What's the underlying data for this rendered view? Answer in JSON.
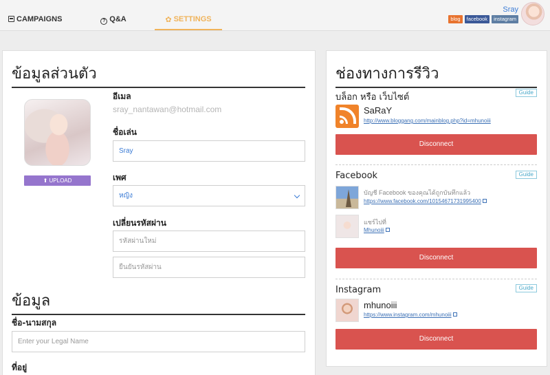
{
  "nav": {
    "tabs": [
      {
        "label": "CAMPAIGNS",
        "icon": "campaigns-icon"
      },
      {
        "label": "Q&A",
        "icon": "question-icon"
      },
      {
        "label": "SETTINGS",
        "icon": "gear-icon",
        "active": true
      }
    ],
    "user": {
      "name": "Sray",
      "badges": [
        "blog",
        "facebook",
        "instagram"
      ]
    }
  },
  "personal": {
    "title": "ข้อมูลส่วนตัว",
    "upload_label": "UPLOAD",
    "email_label": "อีเมล",
    "email_value": "sray_nantawan@hotmail.com",
    "nickname_label": "ชื่อเล่น",
    "nickname_value": "Sray",
    "gender_label": "เพศ",
    "gender_value": "หญิง",
    "password_label": "เปลี่ยนรหัสผ่าน",
    "new_password_placeholder": "รหัสผ่านใหม่",
    "confirm_password_placeholder": "ยืนยันรหัสผ่าน"
  },
  "info": {
    "title": "ข้อมูล",
    "legal_name_label": "ชื่อ-นามสกุล",
    "legal_name_placeholder": "Enter your Legal Name",
    "address_label": "ที่อยู่"
  },
  "channels": {
    "title": "ช่องทางการรีวิว",
    "guide_label": "Guide",
    "disconnect_label": "Disconnect",
    "blog": {
      "title": "บล็อก หรือ เว็บไซต์",
      "name": "SaRaY",
      "url": "http://www.bloggang.com/mainblog.php?id=mhunoiii"
    },
    "facebook": {
      "title": "Facebook",
      "account_note": "บัญชี Facebook ของคุณได้ถูกบันทึกแล้ว",
      "account_url": "https://www.facebook.com/10154671731995400",
      "share_label": "แชร์ไปที่",
      "share_target": "Mhunoiii"
    },
    "instagram": {
      "title": "Instagram",
      "name": "mhunoiii",
      "url": "https://www.instagram.com/mhunoiii"
    }
  }
}
